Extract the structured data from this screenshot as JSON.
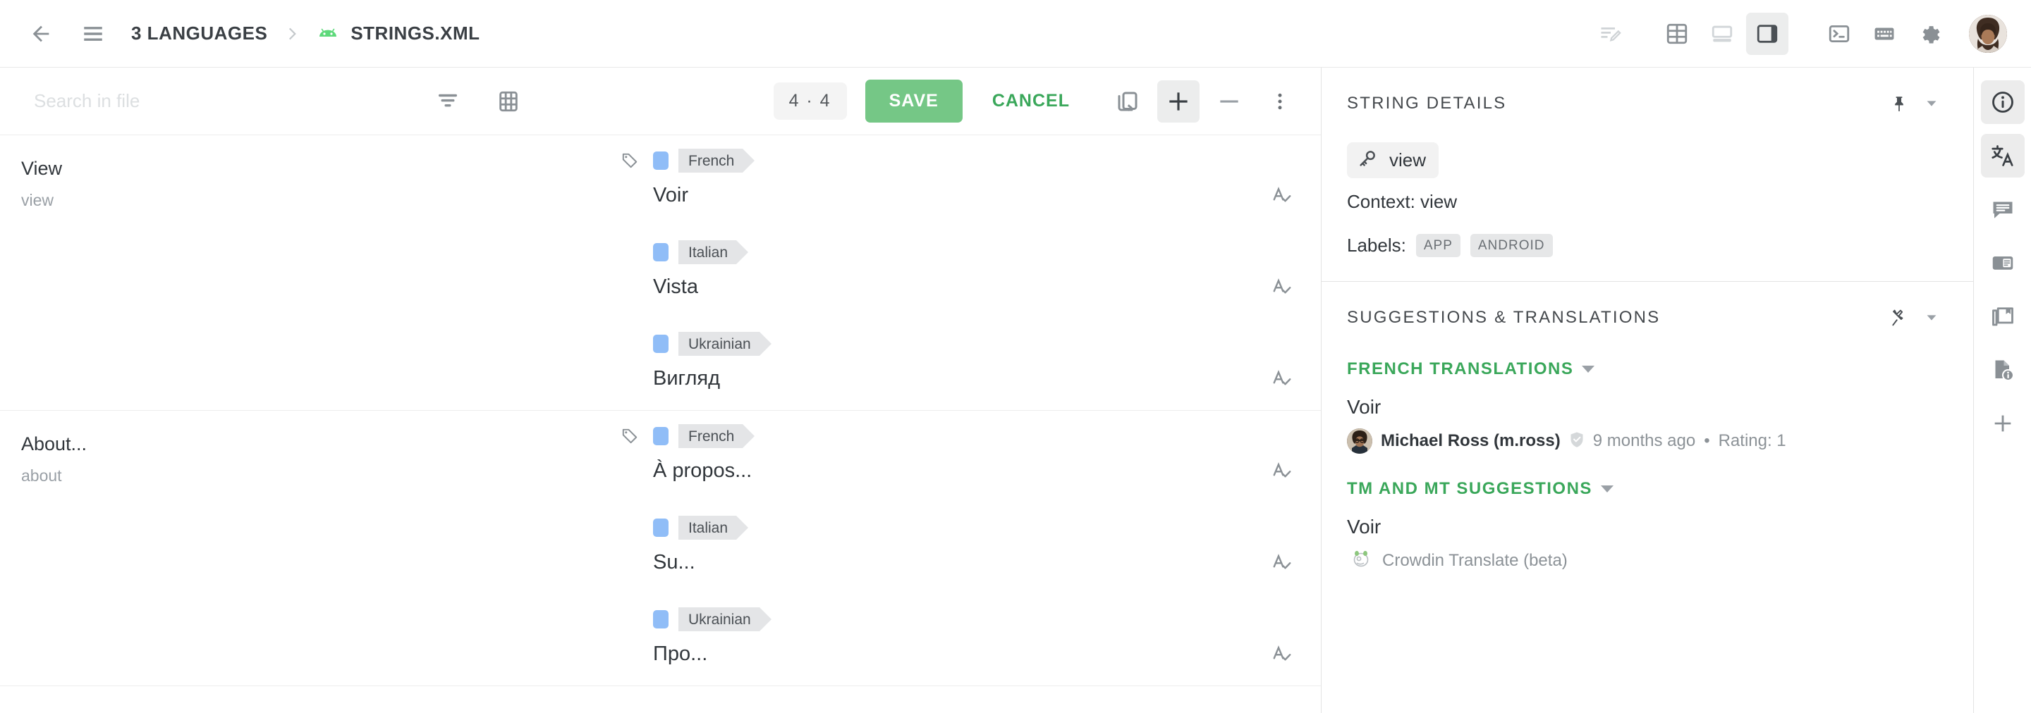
{
  "topbar": {
    "back_icon": "arrow-left-icon",
    "menu_icon": "hamburger-menu-icon",
    "breadcrumb_project": "3 LANGUAGES",
    "breadcrumb_file": "STRINGS.XML",
    "file_type_icon": "android-icon",
    "actions": [
      {
        "name": "edit-lines-icon",
        "active": false
      },
      {
        "name": "table-view-icon",
        "active": false
      },
      {
        "name": "bottom-panel-layout-icon",
        "active": false
      },
      {
        "name": "side-panel-layout-icon",
        "active": true
      },
      {
        "name": "terminal-icon",
        "active": false
      },
      {
        "name": "keyboard-shortcuts-icon",
        "active": false
      },
      {
        "name": "settings-gear-icon",
        "active": false
      }
    ],
    "avatar_alt": "user-avatar"
  },
  "subtoolbar": {
    "search_placeholder": "Search in file",
    "search_value": "",
    "filter_icon": "filter-icon",
    "grid_icon": "grid-view-icon",
    "counter": "4 · 4",
    "save_label": "SAVE",
    "cancel_label": "CANCEL",
    "copy_source_icon": "copy-source-icon",
    "plus_icon": "plus-icon",
    "minus_icon": "minus-icon",
    "more_icon": "more-vertical-icon",
    "save_color": "#75c786",
    "cancel_color": "#3aa75a"
  },
  "editor": {
    "groups": [
      {
        "source_text": "View",
        "source_key": "view",
        "has_tag_icon": true,
        "translations": [
          {
            "language": "French",
            "value": "Voir",
            "dot_color": "#90bdf7",
            "spell_icon": "spellcheck-icon"
          },
          {
            "language": "Italian",
            "value": "Vista",
            "dot_color": "#90bdf7",
            "spell_icon": "spellcheck-icon"
          },
          {
            "language": "Ukrainian",
            "value": "Вигляд",
            "dot_color": "#90bdf7",
            "spell_icon": "spellcheck-icon"
          }
        ]
      },
      {
        "source_text": "About...",
        "source_key": "about",
        "has_tag_icon": true,
        "translations": [
          {
            "language": "French",
            "value": "À propos...",
            "dot_color": "#90bdf7",
            "spell_icon": "spellcheck-icon"
          },
          {
            "language": "Italian",
            "value": "Su...",
            "dot_color": "#90bdf7",
            "spell_icon": "spellcheck-icon"
          },
          {
            "language": "Ukrainian",
            "value": "Про...",
            "dot_color": "#90bdf7",
            "spell_icon": "spellcheck-icon"
          }
        ]
      }
    ]
  },
  "details_panel": {
    "title": "STRING DETAILS",
    "pin_icon": "pin-icon",
    "collapse_icon": "chevron-down-icon",
    "key_icon": "key-icon",
    "key": "view",
    "context": "Context: view",
    "labels_label": "Labels:",
    "labels": [
      "APP",
      "ANDROID"
    ]
  },
  "suggestions_panel": {
    "title": "SUGGESTIONS & TRANSLATIONS",
    "pin_icon": "pin-outline-icon",
    "collapse_icon": "chevron-down-icon",
    "sections": [
      {
        "heading": "FRENCH TRANSLATIONS",
        "items": [
          {
            "text": "Voir",
            "author": "Michael Ross (m.ross)",
            "verified_icon": "verified-shield-icon",
            "time": "9 months ago",
            "separator": "•",
            "rating": "Rating: 1"
          }
        ]
      },
      {
        "heading": "TM AND MT SUGGESTIONS",
        "items": [
          {
            "text": "Voir",
            "engine_icon": "crowdin-logo-icon",
            "engine": "Crowdin Translate (beta)"
          }
        ]
      }
    ],
    "accent_color": "#3aa75a"
  },
  "rail": {
    "items": [
      {
        "name": "info-icon",
        "active": true
      },
      {
        "name": "translate-icon",
        "active": true
      },
      {
        "name": "comments-icon",
        "active": false
      },
      {
        "name": "glossary-card-icon",
        "active": false
      },
      {
        "name": "tm-library-icon",
        "active": false
      },
      {
        "name": "file-info-icon",
        "active": false
      },
      {
        "name": "add-plugin-icon",
        "active": false
      }
    ]
  }
}
